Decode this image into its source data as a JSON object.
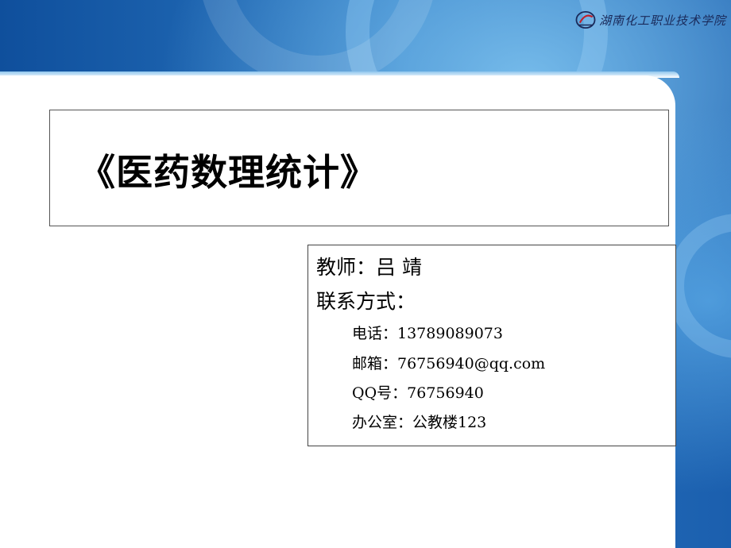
{
  "logo": {
    "text": "湖南化工职业技术学院",
    "icon": "school-logo-icon"
  },
  "title": "《医药数理统计》",
  "teacher": {
    "line": "教师：吕  靖"
  },
  "contact": {
    "heading": "联系方式：",
    "items": [
      "电话：13789089073",
      "邮箱：76756940@qq.com",
      "QQ号：76756940",
      "办公室：公教楼123"
    ]
  },
  "colors": {
    "background_blue": "#1f5fa8",
    "light_blue": "#6fb3e6",
    "text": "#000000"
  }
}
